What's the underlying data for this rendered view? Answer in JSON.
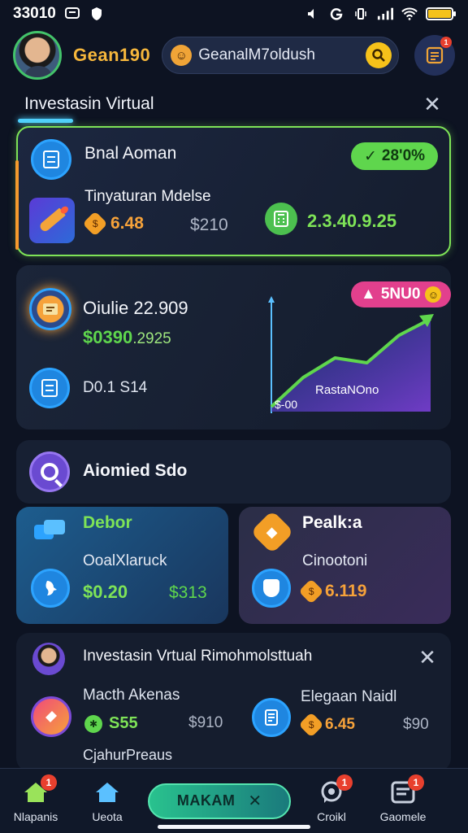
{
  "status_bar": {
    "time": "33010",
    "icons_left": [
      "message-icon",
      "shield-icon"
    ],
    "icons_right": [
      "mute-icon",
      "g-icon",
      "vibrate-icon",
      "signal-icon",
      "wifi-icon",
      "battery-icon"
    ],
    "battery_color": "#f5c21a"
  },
  "header": {
    "username": "Gean190",
    "search_text": "GeanalM7oldush",
    "notification_badge": "1"
  },
  "section": {
    "title": "Investasin Virtual"
  },
  "card1": {
    "title": "Bnal Aoman",
    "badge": "28'0%",
    "subtitle": "Tinyaturan Mdelse",
    "coin_value": "6.48",
    "muted_value": "$210",
    "green_value": "2.3.40.9.25"
  },
  "card2": {
    "title": "Oiulie 22.909",
    "dollar_main": "$0390",
    "dollar_small": ".2925",
    "row_label": "D0.1 S14",
    "badge": "5NU0",
    "chart_label": "RastaNOno",
    "chart_corner_label": "$-00",
    "chart_points": [
      0.05,
      0.35,
      0.55,
      0.5,
      0.78,
      0.95
    ],
    "accent": "#5fd64d"
  },
  "card3": {
    "title": "Aiomied Sdo"
  },
  "card4": {
    "title": "Debor",
    "subtitle": "OoalXlaruck",
    "value_green": "$0.20",
    "value_muted": "$313"
  },
  "card5": {
    "title": "Pealk:a",
    "subtitle": "Cinootoni",
    "value_orange": "6.119"
  },
  "card6": {
    "title": "Investasin Vrtual Rimohmolsttuah",
    "item1_title": "Macth Akenas",
    "item1_coin": "S55",
    "item1_muted": "$910",
    "item2_title": "Elegaan Naidl",
    "item2_coin": "6.45",
    "item2_muted": "$90",
    "item3_title": "CjahurPreaus"
  },
  "bottom_nav": {
    "item1": "Nlapanis",
    "item2": "Ueota",
    "main_label": "MAKAM",
    "item4": "Croikl",
    "item5": "Gaomele",
    "badge": "1"
  }
}
